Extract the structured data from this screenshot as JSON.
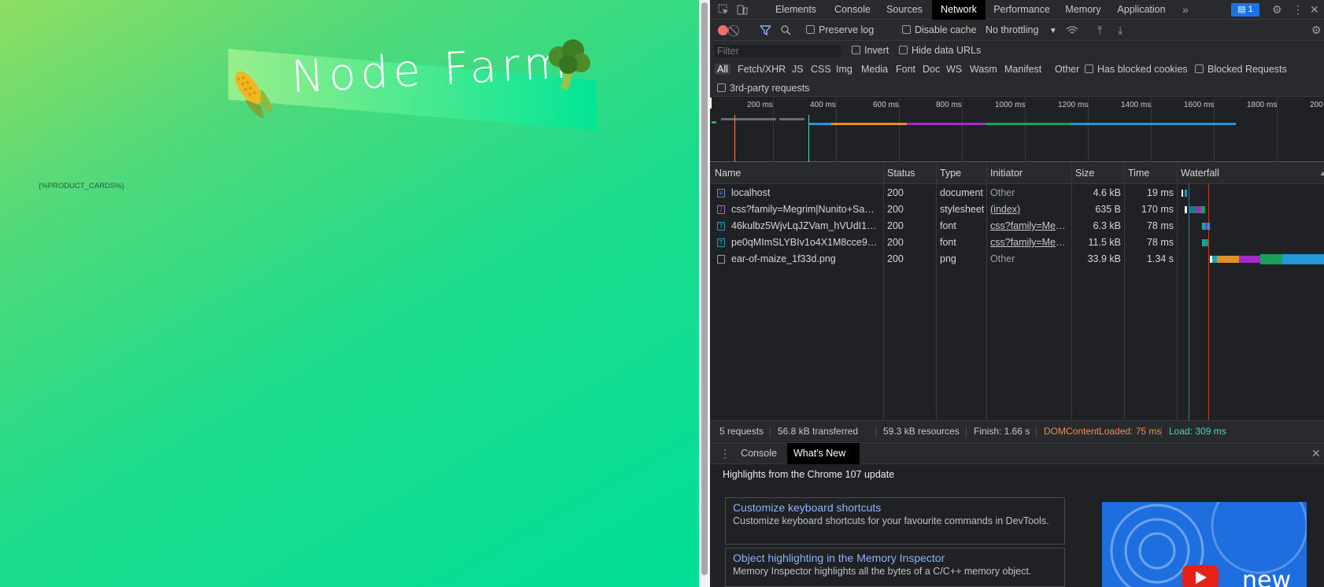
{
  "page": {
    "hero_title": "Node Farm",
    "placeholder": "{%PRODUCT_CARDS%}"
  },
  "devtools": {
    "tabs": [
      "Elements",
      "Console",
      "Sources",
      "Network",
      "Performance",
      "Memory",
      "Application"
    ],
    "active_tab": "Network",
    "issues_badge": "1",
    "toolbar": {
      "preserve_log": "Preserve log",
      "disable_cache": "Disable cache",
      "throttling": "No throttling"
    },
    "filter": {
      "placeholder": "Filter",
      "invert": "Invert",
      "hide_data_urls": "Hide data URLs",
      "types": [
        "All",
        "Fetch/XHR",
        "JS",
        "CSS",
        "Img",
        "Media",
        "Font",
        "Doc",
        "WS",
        "Wasm",
        "Manifest",
        "Other"
      ],
      "has_blocked_cookies": "Has blocked cookies",
      "blocked_requests": "Blocked Requests",
      "third_party": "3rd-party requests"
    },
    "overview_ticks": [
      "200 ms",
      "400 ms",
      "600 ms",
      "800 ms",
      "1000 ms",
      "1200 ms",
      "1400 ms",
      "1600 ms",
      "1800 ms",
      "200"
    ],
    "table": {
      "headers": [
        "Name",
        "Status",
        "Type",
        "Initiator",
        "Size",
        "Time",
        "Waterfall"
      ],
      "rows": [
        {
          "name": "localhost",
          "status": "200",
          "type": "document",
          "initiator": "Other",
          "size": "4.6 kB",
          "time": "19 ms"
        },
        {
          "name": "css?family=Megrim|Nunito+Sans...",
          "status": "200",
          "type": "stylesheet",
          "initiator": "(index)",
          "size": "635 B",
          "time": "170 ms"
        },
        {
          "name": "46kulbz5WjvLqJZVam_hVUdI1w...",
          "status": "200",
          "type": "font",
          "initiator": "css?family=Meg...",
          "size": "6.3 kB",
          "time": "78 ms"
        },
        {
          "name": "pe0qMImSLYBIv1o4X1M8cce9I9...",
          "status": "200",
          "type": "font",
          "initiator": "css?family=Meg...",
          "size": "11.5 kB",
          "time": "78 ms"
        },
        {
          "name": "ear-of-maize_1f33d.png",
          "status": "200",
          "type": "png",
          "initiator": "Other",
          "size": "33.9 kB",
          "time": "1.34 s"
        }
      ]
    },
    "status": {
      "requests": "5 requests",
      "transferred": "56.8 kB transferred",
      "resources": "59.3 kB resources",
      "finish": "Finish: 1.66 s",
      "dom_content_loaded": "DOMContentLoaded: 75 ms",
      "load": "Load: 309 ms"
    },
    "drawer": {
      "tabs": [
        "Console",
        "What's New"
      ],
      "active_tab": "What's New",
      "heading": "Highlights from the Chrome 107 update",
      "cards": [
        {
          "title": "Customize keyboard shortcuts",
          "desc": "Customize keyboard shortcuts for your favourite commands in DevTools."
        },
        {
          "title": "Object highlighting in the Memory Inspector",
          "desc": "Memory Inspector highlights all the bytes of a C/C++ memory object."
        }
      ],
      "promo_text": "new"
    },
    "colors": {
      "dom_content_loaded": "#f28b54",
      "load": "#4fd1c5",
      "link": "#8ab4f8"
    }
  }
}
